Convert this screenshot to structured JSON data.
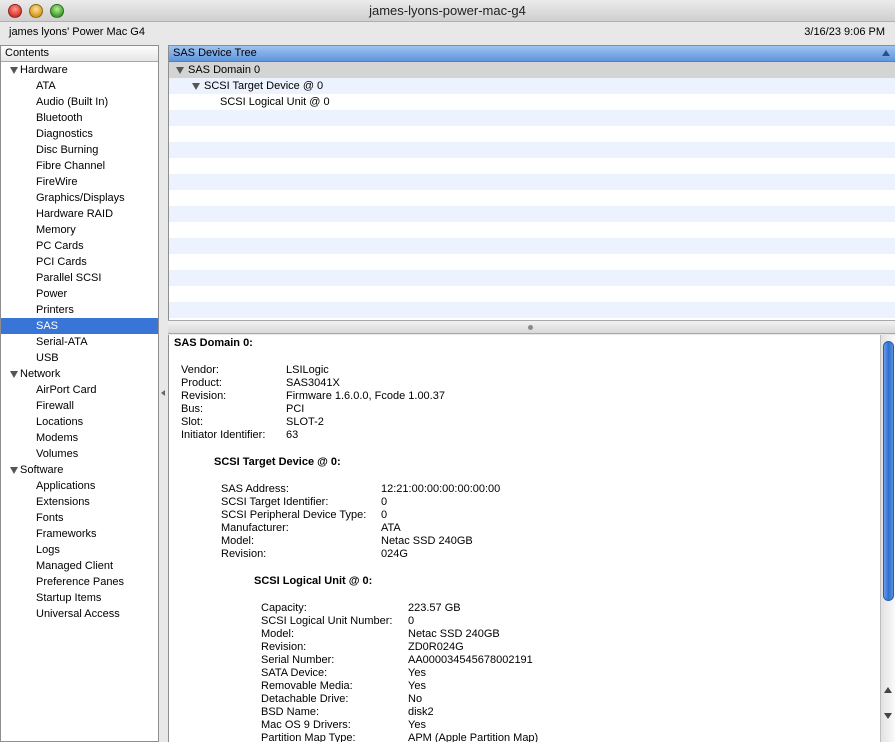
{
  "window": {
    "title": "james-lyons-power-mac-g4"
  },
  "infobar": {
    "computer_name": "james lyons' Power Mac G4",
    "datetime": "3/16/23 9:06 PM"
  },
  "sidebar": {
    "header": "Contents",
    "groups": [
      {
        "label": "Hardware",
        "items": [
          "ATA",
          "Audio (Built In)",
          "Bluetooth",
          "Diagnostics",
          "Disc Burning",
          "Fibre Channel",
          "FireWire",
          "Graphics/Displays",
          "Hardware RAID",
          "Memory",
          "PC Cards",
          "PCI Cards",
          "Parallel SCSI",
          "Power",
          "Printers",
          "SAS",
          "Serial-ATA",
          "USB"
        ]
      },
      {
        "label": "Network",
        "items": [
          "AirPort Card",
          "Firewall",
          "Locations",
          "Modems",
          "Volumes"
        ]
      },
      {
        "label": "Software",
        "items": [
          "Applications",
          "Extensions",
          "Fonts",
          "Frameworks",
          "Logs",
          "Managed Client",
          "Preference Panes",
          "Startup Items",
          "Universal Access"
        ]
      }
    ],
    "selected": "SAS"
  },
  "device_tree": {
    "column_header": "SAS Device Tree",
    "rows": [
      "SAS Domain 0",
      "SCSI Target Device @ 0",
      "SCSI Logical Unit @ 0"
    ]
  },
  "detail": {
    "domain": {
      "title": "SAS Domain 0:",
      "fields": [
        {
          "key": "Vendor:",
          "value": "LSILogic"
        },
        {
          "key": "Product:",
          "value": "SAS3041X"
        },
        {
          "key": "Revision:",
          "value": "Firmware 1.6.0.0, Fcode 1.00.37"
        },
        {
          "key": "Bus:",
          "value": "PCI"
        },
        {
          "key": "Slot:",
          "value": "SLOT-2"
        },
        {
          "key": "Initiator Identifier:",
          "value": "63"
        }
      ]
    },
    "target": {
      "title": "SCSI Target Device @ 0:",
      "fields": [
        {
          "key": "SAS Address:",
          "value": "12:21:00:00:00:00:00:00"
        },
        {
          "key": "SCSI Target Identifier:",
          "value": "0"
        },
        {
          "key": "SCSI Peripheral Device Type:",
          "value": "0"
        },
        {
          "key": "Manufacturer:",
          "value": "ATA"
        },
        {
          "key": "Model:",
          "value": "Netac SSD 240GB"
        },
        {
          "key": "Revision:",
          "value": "024G"
        }
      ]
    },
    "lun": {
      "title": "SCSI Logical Unit @ 0:",
      "fields": [
        {
          "key": "Capacity:",
          "value": "223.57 GB"
        },
        {
          "key": "SCSI Logical Unit Number:",
          "value": "0"
        },
        {
          "key": "Model:",
          "value": "Netac SSD 240GB"
        },
        {
          "key": "Revision:",
          "value": "ZD0R024G"
        },
        {
          "key": "Serial Number:",
          "value": "AA000034545678002191"
        },
        {
          "key": "SATA Device:",
          "value": "Yes"
        },
        {
          "key": "Removable Media:",
          "value": "Yes"
        },
        {
          "key": "Detachable Drive:",
          "value": "No"
        },
        {
          "key": "BSD Name:",
          "value": "disk2"
        },
        {
          "key": "Mac OS 9 Drivers:",
          "value": "Yes"
        },
        {
          "key": "Partition Map Type:",
          "value": "APM (Apple Partition Map)"
        }
      ]
    }
  },
  "colors": {
    "selection": "#3875d7",
    "column_header": "#7aa8e6",
    "stripe": "#edf3fe"
  }
}
